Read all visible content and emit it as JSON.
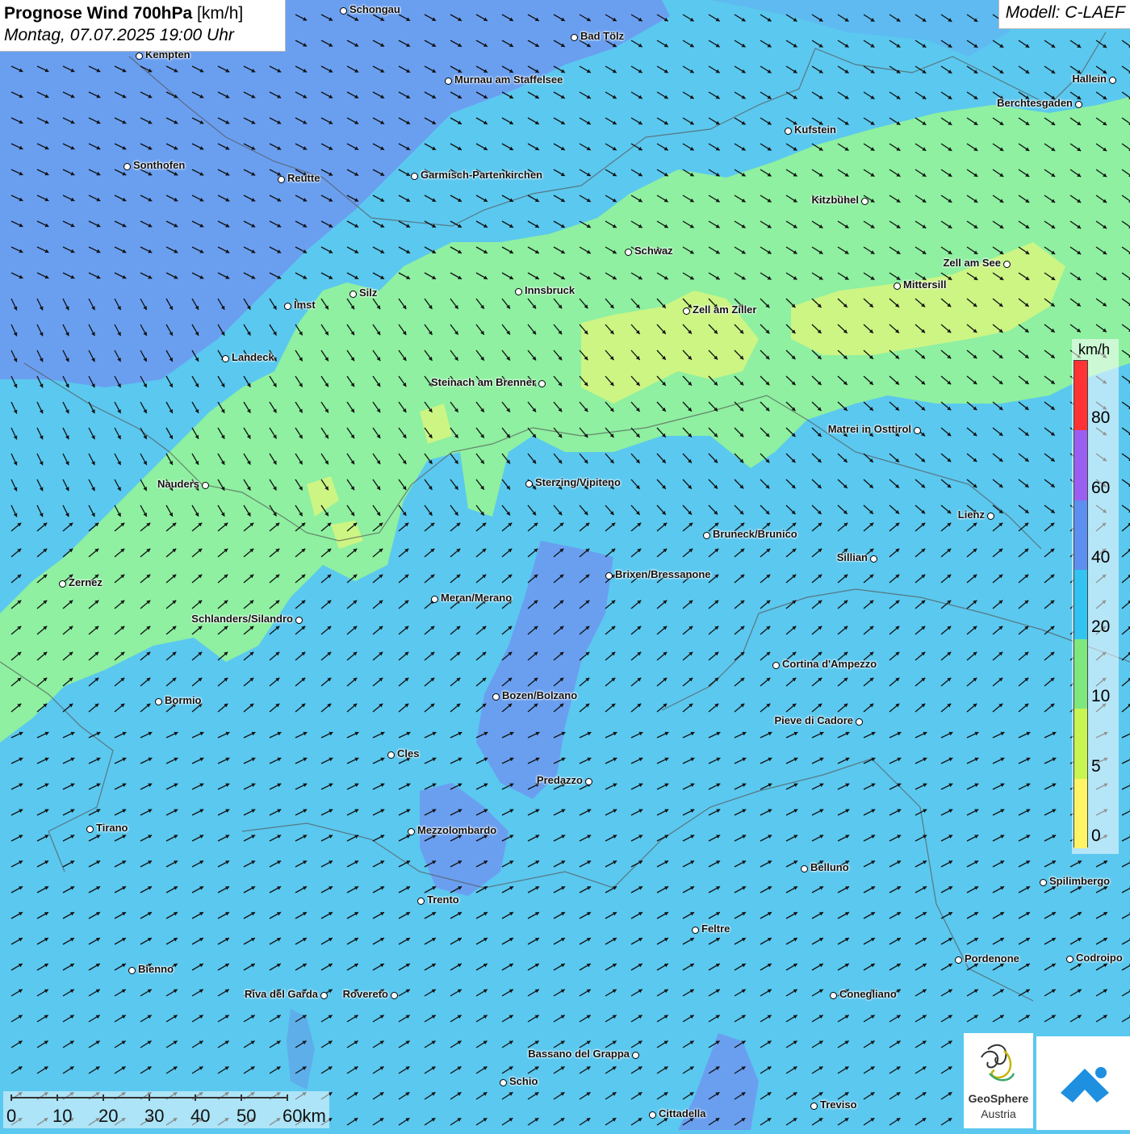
{
  "title": {
    "main_bold": "Prognose Wind 700hPa",
    "main_unit": " [km/h]",
    "subtitle": "Montag, 07.07.2025 19:00 Uhr"
  },
  "model": "Modell: C-LAEF",
  "legend": {
    "unit": "km/h",
    "levels": [
      {
        "label": "80",
        "color": "#ff3333"
      },
      {
        "label": "60",
        "color": "#9a5ff0"
      },
      {
        "label": "40",
        "color": "#5c8ff0"
      },
      {
        "label": "20",
        "color": "#33c3f0"
      },
      {
        "label": "10",
        "color": "#7ee87f"
      },
      {
        "label": "5",
        "color": "#c8f550"
      },
      {
        "label": "0",
        "color": "#fff466"
      }
    ]
  },
  "scale_bar": {
    "labels": [
      "0",
      "10",
      "20",
      "30",
      "40",
      "50",
      "60km"
    ]
  },
  "logos": {
    "geosphere_line1": "GeoSphere",
    "geosphere_line2": "Austria"
  },
  "cities": [
    {
      "name": "Schongau"
    },
    {
      "name": "Bad Tölz"
    },
    {
      "name": "Kempten"
    },
    {
      "name": "Murnau am Staffelsee"
    },
    {
      "name": "Hallein"
    },
    {
      "name": "Berchtesgaden"
    },
    {
      "name": "Kufstein"
    },
    {
      "name": "Sonthofen"
    },
    {
      "name": "Reutte"
    },
    {
      "name": "Garmisch-Partenkirchen"
    },
    {
      "name": "Kitzbühel"
    },
    {
      "name": "Schwaz"
    },
    {
      "name": "Zell am See"
    },
    {
      "name": "Innsbruck"
    },
    {
      "name": "Mittersill"
    },
    {
      "name": "Silz"
    },
    {
      "name": "Imst"
    },
    {
      "name": "Zell am Ziller"
    },
    {
      "name": "Landeck"
    },
    {
      "name": "Steinach am Brenner"
    },
    {
      "name": "Matrei in Osttirol"
    },
    {
      "name": "Nauders"
    },
    {
      "name": "Sterzing/Vipiteno"
    },
    {
      "name": "Lienz"
    },
    {
      "name": "Bruneck/Brunico"
    },
    {
      "name": "Sillian"
    },
    {
      "name": "Zernez"
    },
    {
      "name": "Brixen/Bressanone"
    },
    {
      "name": "Meran/Merano"
    },
    {
      "name": "Schlanders/Silandro"
    },
    {
      "name": "Cortina d'Ampezzo"
    },
    {
      "name": "Bozen/Bolzano"
    },
    {
      "name": "Bormio"
    },
    {
      "name": "Pieve di Cadore"
    },
    {
      "name": "Cles"
    },
    {
      "name": "Predazzo"
    },
    {
      "name": "Tirano"
    },
    {
      "name": "Mezzolombardo"
    },
    {
      "name": "Belluno"
    },
    {
      "name": "Spilimbergo"
    },
    {
      "name": "Trento"
    },
    {
      "name": "Feltre"
    },
    {
      "name": "Pordenone"
    },
    {
      "name": "Codroipo"
    },
    {
      "name": "Bienno"
    },
    {
      "name": "Riva del Garda"
    },
    {
      "name": "Rovereto"
    },
    {
      "name": "Conegliano"
    },
    {
      "name": "Bassano del Grappa"
    },
    {
      "name": "Schio"
    },
    {
      "name": "Treviso"
    },
    {
      "name": "Cittadella"
    }
  ]
}
